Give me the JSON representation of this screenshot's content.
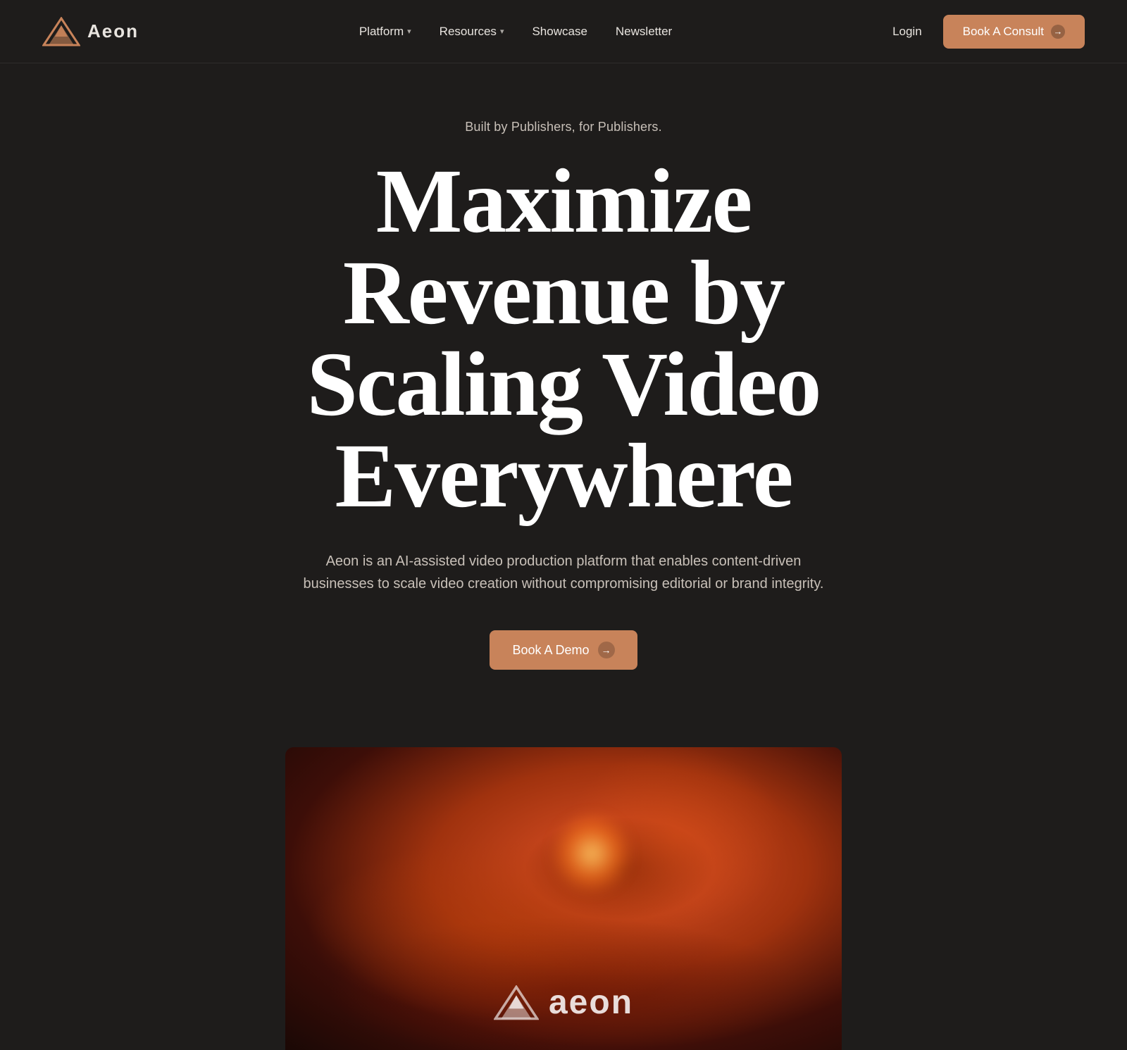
{
  "nav": {
    "logo_alt": "Aeon",
    "links": [
      {
        "id": "platform",
        "label": "Platform",
        "has_dropdown": true
      },
      {
        "id": "resources",
        "label": "Resources",
        "has_dropdown": true
      },
      {
        "id": "showcase",
        "label": "Showcase",
        "has_dropdown": false
      },
      {
        "id": "newsletter",
        "label": "Newsletter",
        "has_dropdown": false
      }
    ],
    "login_label": "Login",
    "book_consult_label": "Book A Consult"
  },
  "hero": {
    "tagline": "Built by Publishers, for Publishers.",
    "headline": "Maximize Revenue by Scaling Video Everywhere",
    "subtext": "Aeon is an AI-assisted video production platform that enables content-driven businesses to scale video creation without compromising editorial or brand integrity.",
    "cta_label": "Book A Demo"
  },
  "video_preview": {
    "logo_text": "aeon"
  },
  "icons": {
    "arrow": "→",
    "chevron": "▾"
  }
}
